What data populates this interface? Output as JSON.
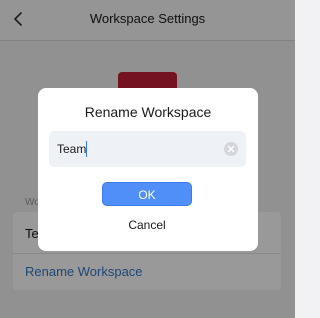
{
  "nav": {
    "title": "Workspace Settings"
  },
  "section": {
    "label": "Wo"
  },
  "card": {
    "row1_label": "Te",
    "row2_label": "Rename Workspace"
  },
  "dialog": {
    "title": "Rename Workspace",
    "input_value": "Team",
    "ok_label": "OK",
    "cancel_label": "Cancel"
  },
  "colors": {
    "accent": "#4f8ff7",
    "link": "#3478c6",
    "brand": "#c41e3a"
  },
  "icons": {
    "back": "chevron-left-icon",
    "clear": "clear-circle-icon"
  }
}
